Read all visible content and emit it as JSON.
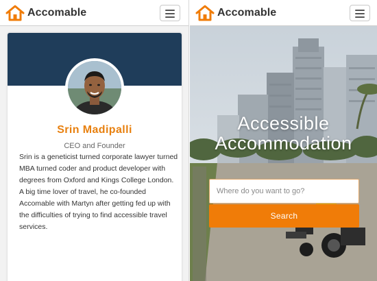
{
  "brand": {
    "name": "Accomable",
    "accent_color": "#f07c08",
    "icon": "house-icon"
  },
  "profile": {
    "name": "Srin Madipalli",
    "role": "CEO and Founder",
    "bio": "Srin is a geneticist turned corporate lawyer turned MBA turned coder and product developer with degrees from Oxford and Kings College London. A big time lover of travel, he co-founded Accomable with Martyn after getting fed up with the difficulties of trying to find accessible travel services.",
    "banner_color": "#1f3d5a",
    "name_color": "#e8800f"
  },
  "hero": {
    "title": "Accessible Accommodation",
    "search_placeholder": "Where do you want to go?",
    "search_button": "Search"
  },
  "icons": {
    "menu": "hamburger-menu-icon",
    "logo": "house-icon"
  }
}
